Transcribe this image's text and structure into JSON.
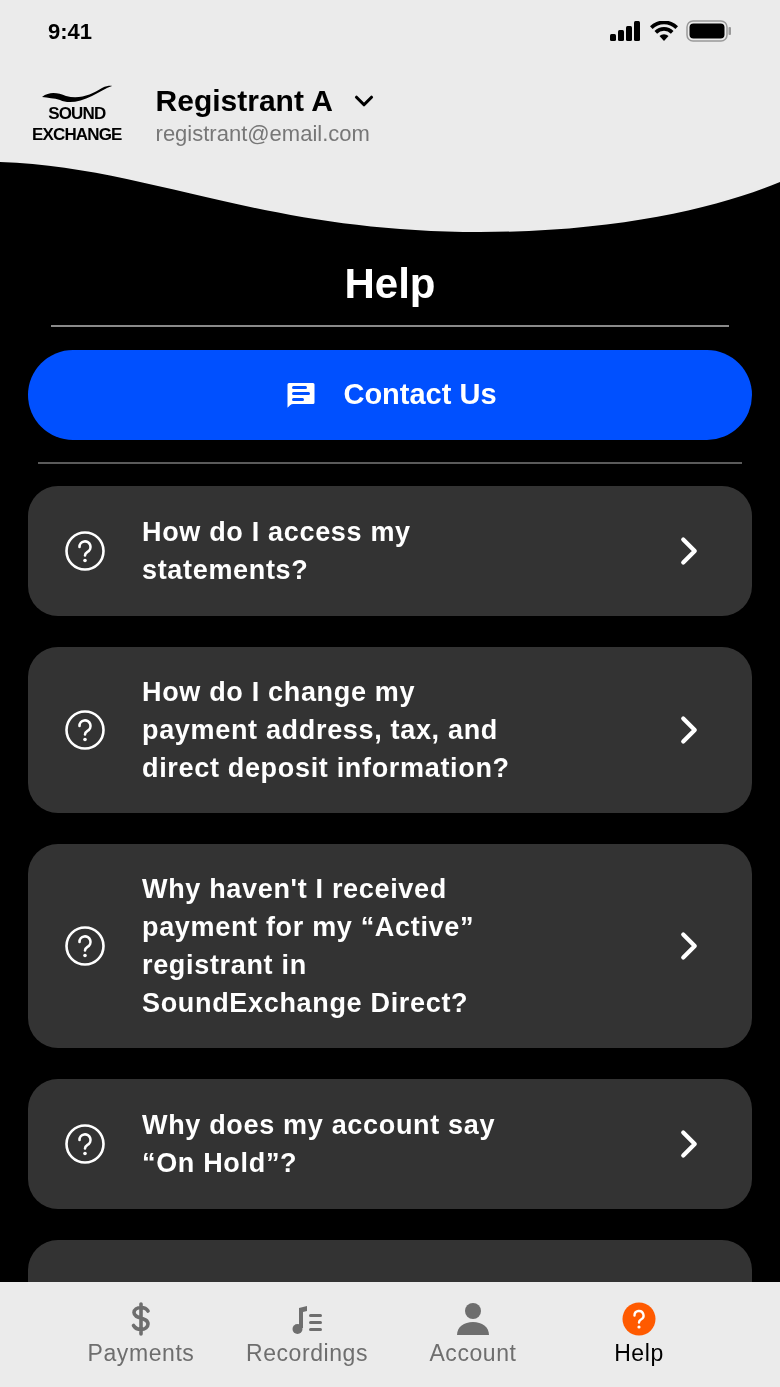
{
  "status_bar": {
    "time": "9:41"
  },
  "header": {
    "logo_text": [
      "SOUND",
      "EXCHANGE"
    ],
    "account_name": "Registrant A",
    "account_email": "registrant@email.com"
  },
  "title": "Help",
  "contact_button": {
    "label": "Contact Us"
  },
  "faqs": [
    {
      "question": "How do I access my statements?"
    },
    {
      "question": "How do I change my payment address, tax, and direct deposit information?"
    },
    {
      "question": "Why haven't I received payment for my “Active” registrant in SoundExchange Direct?"
    },
    {
      "question": "Why does my account say “On Hold”?"
    }
  ],
  "tab_bar": [
    {
      "label": "Payments",
      "kind": "dollar",
      "selected": false
    },
    {
      "label": "Recordings",
      "kind": "music",
      "selected": false
    },
    {
      "label": "Account",
      "kind": "person",
      "selected": false
    },
    {
      "label": "Help",
      "kind": "help",
      "selected": true
    }
  ]
}
